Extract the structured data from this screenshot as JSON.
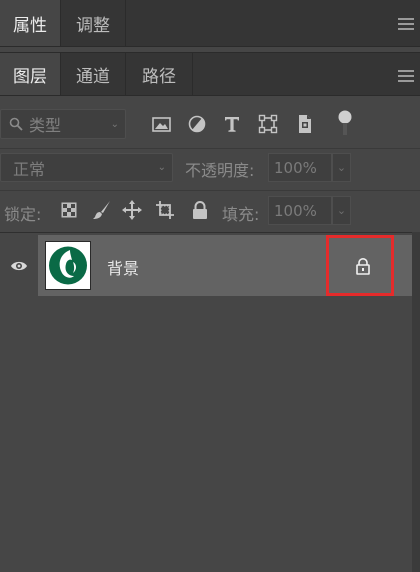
{
  "top_tabs": {
    "properties": "属性",
    "adjustments": "调整"
  },
  "layers_tabs": {
    "layers": "图层",
    "channels": "通道",
    "paths": "路径"
  },
  "filter": {
    "kind_label": "类型",
    "icons": [
      "image-filter-icon",
      "adjustment-filter-icon",
      "type-filter-icon",
      "shape-filter-icon",
      "smart-object-filter-icon",
      "filter-toggle-icon"
    ]
  },
  "blend": {
    "mode": "正常",
    "opacity_label": "不透明度:",
    "opacity_value": "100%"
  },
  "lock": {
    "label": "锁定:",
    "fill_label": "填充:",
    "fill_value": "100%",
    "icons": [
      "lock-transparent-pixels-icon",
      "lock-image-pixels-icon",
      "lock-position-icon",
      "lock-artboard-icon",
      "lock-all-icon"
    ]
  },
  "layer": {
    "name": "背景",
    "visible": true,
    "locked": true,
    "highlight_color": "#e52b2b",
    "thumbnail_color": "#0a6a46"
  }
}
